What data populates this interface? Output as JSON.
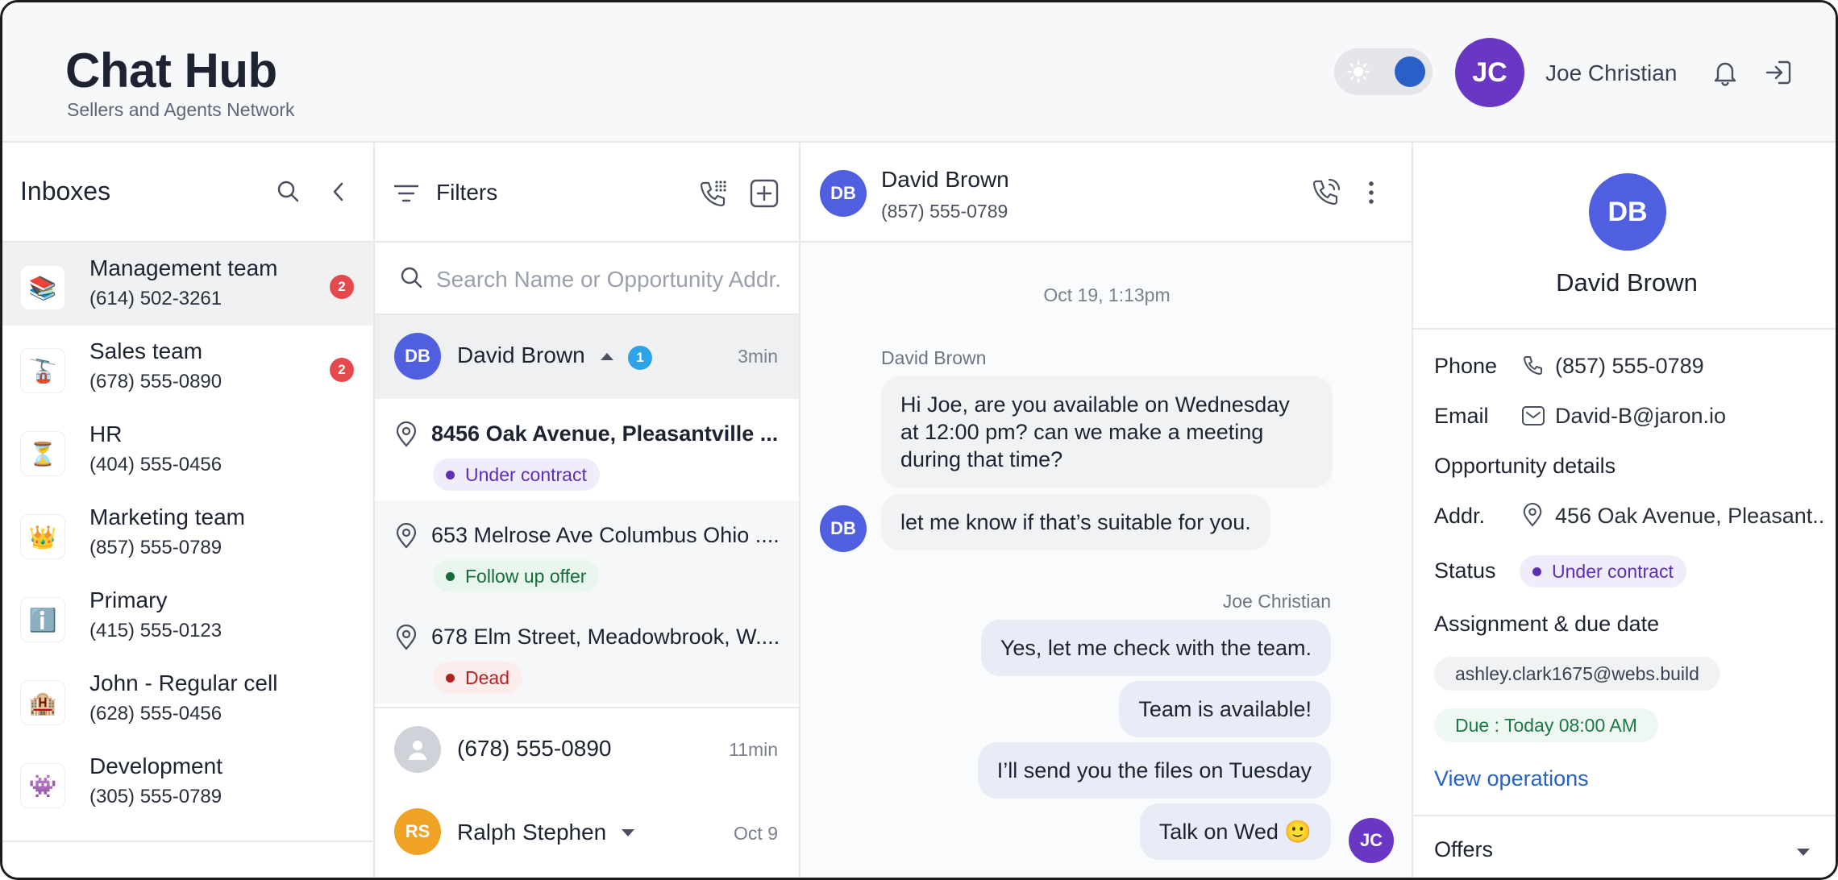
{
  "header": {
    "title": "Chat Hub",
    "subtitle": "Sellers and Agents Network",
    "user_initials": "JC",
    "user_name": "Joe Christian"
  },
  "inboxes": {
    "title": "Inboxes",
    "items": [
      {
        "name": "Management team",
        "phone": "(614) 502-3261",
        "icon": "books-icon",
        "emoji": "📚",
        "unread": "2"
      },
      {
        "name": "Sales team",
        "phone": "(678) 555-0890",
        "icon": "cable-car-icon",
        "emoji": "🚡",
        "unread": "2"
      },
      {
        "name": "HR",
        "phone": "(404) 555-0456",
        "icon": "hourglass-icon",
        "emoji": "⏳",
        "unread": ""
      },
      {
        "name": "Marketing team",
        "phone": "(857) 555-0789",
        "icon": "crown-icon",
        "emoji": "👑",
        "unread": ""
      },
      {
        "name": "Primary",
        "phone": "(415) 555-0123",
        "icon": "info-icon",
        "emoji": "ℹ️",
        "unread": ""
      },
      {
        "name": "John - Regular cell",
        "phone": "(628) 555-0456",
        "icon": "hotel-icon",
        "emoji": "🏨",
        "unread": ""
      },
      {
        "name": "Development",
        "phone": "(305) 555-0789",
        "icon": "alien-monster-icon",
        "emoji": "👾",
        "unread": ""
      }
    ]
  },
  "conversations": {
    "filters_label": "Filters",
    "search_placeholder": "Search Name or Opportunity Addr.",
    "rows": [
      {
        "initials": "DB",
        "name": "David Brown",
        "badge": "1",
        "time": "3min"
      },
      {
        "initials": "",
        "name": "(678) 555-0890",
        "time": "11min"
      },
      {
        "initials": "RS",
        "name": "Ralph Stephen",
        "time": "Oct 9"
      }
    ],
    "opportunities": [
      {
        "address": "8456 Oak Avenue, Pleasantville ...",
        "status": "Under contract"
      },
      {
        "address": "653 Melrose Ave Columbus Ohio ....",
        "status": "Follow up offer"
      },
      {
        "address": "678 Elm Street, Meadowbrook, W....",
        "status": "Dead"
      }
    ]
  },
  "chat": {
    "contact_initials": "DB",
    "contact_name": "David Brown",
    "contact_phone": "(857) 555-0789",
    "date": "Oct 19, 1:13pm",
    "incoming_sender": "David Brown",
    "incoming": [
      "Hi Joe, are you available on Wednesday at 12:00 pm? can we make a meeting during that time?",
      "let me know if that’s suitable for you."
    ],
    "outgoing_sender": "Joe Christian",
    "outgoing": [
      "Yes, let me check with the team.",
      "Team is available!",
      "I’ll send you  the files on Tuesday",
      "Talk on Wed 🙂"
    ],
    "me_initials": "JC"
  },
  "details": {
    "initials": "DB",
    "name": "David Brown",
    "phone_label": "Phone",
    "phone": "(857) 555-0789",
    "email_label": "Email",
    "email": "David-B@jaron.io",
    "opportunity_label": "Opportunity details",
    "addr_label": "Addr.",
    "addr": "456 Oak Avenue, Pleasant..",
    "status_label": "Status",
    "status": "Under contract",
    "assignment_label": "Assignment  & due date",
    "assignee": "ashley.clark1675@webs.build",
    "due": "Due : Today 08:00 AM",
    "view_ops": "View operations",
    "offers_label": "Offers"
  },
  "colors": {
    "accent_blue": "#2563c9",
    "avatar_db": "#4f5fe0",
    "avatar_jc": "#6a37c4",
    "avatar_rs": "#f0a224",
    "badge_red": "#e5484d",
    "badge_blue": "#2ea3e8"
  }
}
